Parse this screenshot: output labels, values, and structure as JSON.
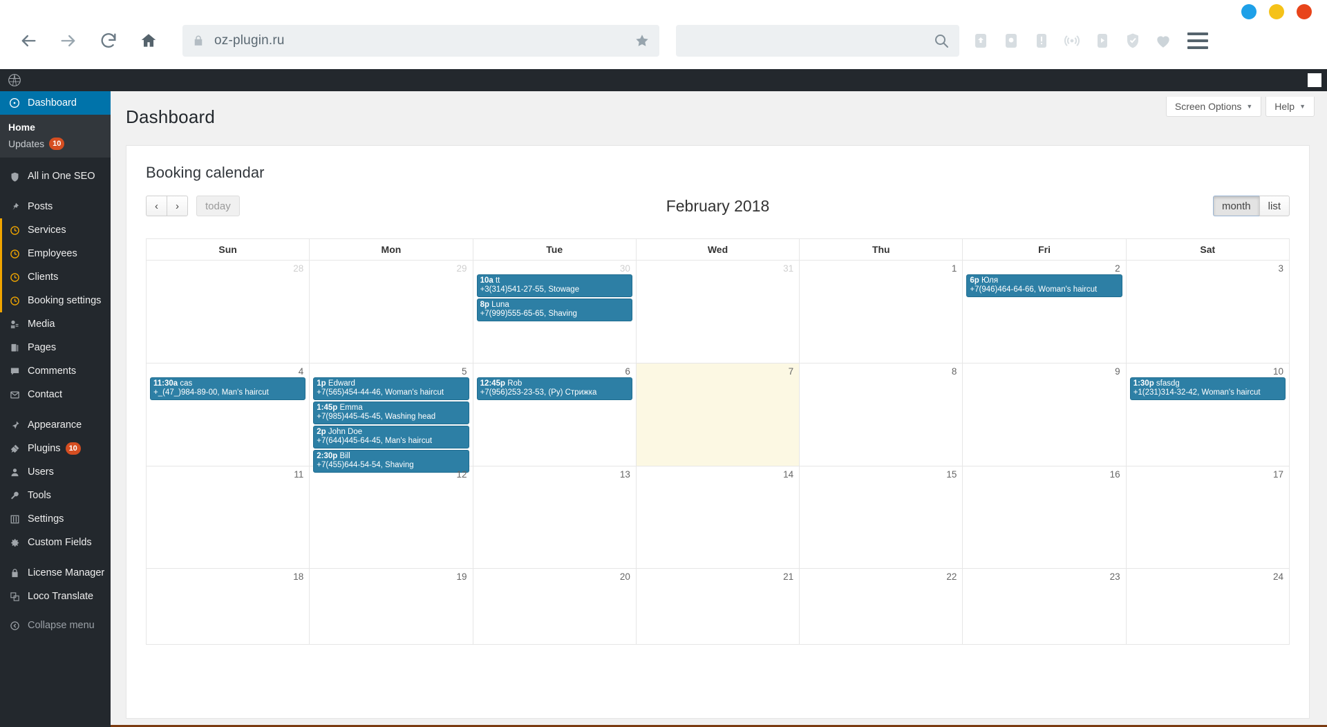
{
  "browser": {
    "url": "oz-plugin.ru",
    "url_lock_icon": "lock-icon",
    "bookmark_icon": "star-icon",
    "search_placeholder": "",
    "search_value": "",
    "nav": {
      "back": "back-arrow-icon",
      "forward": "forward-arrow-icon",
      "reload": "reload-icon",
      "home": "home-icon"
    },
    "extensions": [
      "upload-icon",
      "camera-icon",
      "alert-icon",
      "broadcast-icon",
      "save-page-icon",
      "shield-check-icon",
      "heart-icon"
    ],
    "menu_icon": "hamburger-menu-icon",
    "window_dots": [
      "#1ea0e8",
      "#f5c218",
      "#e8441a"
    ]
  },
  "adminbar": {
    "logo": "wordpress-logo-icon"
  },
  "sidebar": {
    "items": [
      {
        "label": "Dashboard",
        "icon": "dashboard-icon",
        "current": true,
        "badge": null
      },
      {
        "label": "All in One SEO",
        "icon": "shield-icon",
        "current": false,
        "badge": null
      },
      {
        "label": "Posts",
        "icon": "pin-icon",
        "current": false,
        "badge": null
      },
      {
        "label": "Services",
        "icon": "clock-icon",
        "current": false,
        "badge": null
      },
      {
        "label": "Employees",
        "icon": "clock-icon",
        "current": false,
        "badge": null
      },
      {
        "label": "Clients",
        "icon": "clock-icon",
        "current": false,
        "badge": null
      },
      {
        "label": "Booking settings",
        "icon": "clock-icon",
        "current": false,
        "badge": null
      },
      {
        "label": "Media",
        "icon": "media-icon",
        "current": false,
        "badge": null
      },
      {
        "label": "Pages",
        "icon": "pages-icon",
        "current": false,
        "badge": null
      },
      {
        "label": "Comments",
        "icon": "comments-icon",
        "current": false,
        "badge": null
      },
      {
        "label": "Contact",
        "icon": "envelope-icon",
        "current": false,
        "badge": null
      },
      {
        "label": "Appearance",
        "icon": "brush-icon",
        "current": false,
        "badge": null
      },
      {
        "label": "Plugins",
        "icon": "plug-icon",
        "current": false,
        "badge": "10"
      },
      {
        "label": "Users",
        "icon": "user-icon",
        "current": false,
        "badge": null
      },
      {
        "label": "Tools",
        "icon": "wrench-icon",
        "current": false,
        "badge": null
      },
      {
        "label": "Settings",
        "icon": "settings-sliders-icon",
        "current": false,
        "badge": null
      },
      {
        "label": "Custom Fields",
        "icon": "gear-icon",
        "current": false,
        "badge": null
      },
      {
        "label": "License Manager",
        "icon": "lock-icon",
        "current": false,
        "badge": null
      },
      {
        "label": "Loco Translate",
        "icon": "translate-icon",
        "current": false,
        "badge": null
      },
      {
        "label": "Collapse menu",
        "icon": "collapse-icon",
        "current": false,
        "badge": null
      }
    ],
    "submenu": {
      "home": "Home",
      "updates": "Updates",
      "updates_badge": "10"
    }
  },
  "screen_meta": {
    "screen_options": "Screen Options",
    "help": "Help"
  },
  "page": {
    "title": "Dashboard",
    "panel_title": "Booking calendar"
  },
  "calendar": {
    "prev_label": "‹",
    "next_label": "›",
    "today_label": "today",
    "month_title": "February 2018",
    "view_month": "month",
    "view_list": "list",
    "active_view": "month",
    "day_headers": [
      "Sun",
      "Mon",
      "Tue",
      "Wed",
      "Thu",
      "Fri",
      "Sat"
    ],
    "event_color": "#2d7fa5",
    "today_bg": "#fcf8e3",
    "weeks": [
      {
        "days": [
          {
            "num": "28",
            "other": true,
            "today": false,
            "events": []
          },
          {
            "num": "29",
            "other": true,
            "today": false,
            "events": []
          },
          {
            "num": "30",
            "other": true,
            "today": false,
            "events": [
              {
                "time": "10a",
                "title": "tt",
                "sub": "+3(314)541-27-55, Stowage"
              },
              {
                "time": "8p",
                "title": "Luna",
                "sub": "+7(999)555-65-65, Shaving"
              }
            ]
          },
          {
            "num": "31",
            "other": true,
            "today": false,
            "events": []
          },
          {
            "num": "1",
            "other": false,
            "today": false,
            "events": []
          },
          {
            "num": "2",
            "other": false,
            "today": false,
            "events": [
              {
                "time": "6p",
                "title": "Юля",
                "sub": "+7(946)464-64-66, Woman's haircut"
              }
            ]
          },
          {
            "num": "3",
            "other": false,
            "today": false,
            "events": []
          }
        ]
      },
      {
        "days": [
          {
            "num": "4",
            "other": false,
            "today": false,
            "events": [
              {
                "time": "11:30a",
                "title": "cas",
                "sub": "+_(47_)984-89-00, Man's haircut"
              }
            ]
          },
          {
            "num": "5",
            "other": false,
            "today": false,
            "events": [
              {
                "time": "1p",
                "title": "Edward",
                "sub": "+7(565)454-44-46, Woman's haircut"
              },
              {
                "time": "1:45p",
                "title": "Emma",
                "sub": "+7(985)445-45-45, Washing head"
              },
              {
                "time": "2p",
                "title": "John Doe",
                "sub": "+7(644)445-64-45, Man's haircut"
              },
              {
                "time": "2:30p",
                "title": "Bill",
                "sub": "+7(455)644-54-54, Shaving"
              }
            ]
          },
          {
            "num": "6",
            "other": false,
            "today": false,
            "events": [
              {
                "time": "12:45p",
                "title": "Rob",
                "sub": "+7(956)253-23-53, (Ру) Стрижка"
              }
            ]
          },
          {
            "num": "7",
            "other": false,
            "today": true,
            "events": []
          },
          {
            "num": "8",
            "other": false,
            "today": false,
            "events": []
          },
          {
            "num": "9",
            "other": false,
            "today": false,
            "events": []
          },
          {
            "num": "10",
            "other": false,
            "today": false,
            "events": [
              {
                "time": "1:30p",
                "title": "sfasdg",
                "sub": "+1(231)314-32-42, Woman's haircut"
              }
            ]
          }
        ]
      },
      {
        "days": [
          {
            "num": "11",
            "other": false,
            "today": false,
            "events": []
          },
          {
            "num": "12",
            "other": false,
            "today": false,
            "events": []
          },
          {
            "num": "13",
            "other": false,
            "today": false,
            "events": []
          },
          {
            "num": "14",
            "other": false,
            "today": false,
            "events": []
          },
          {
            "num": "15",
            "other": false,
            "today": false,
            "events": []
          },
          {
            "num": "16",
            "other": false,
            "today": false,
            "events": []
          },
          {
            "num": "17",
            "other": false,
            "today": false,
            "events": []
          }
        ]
      },
      {
        "days": [
          {
            "num": "18",
            "other": false,
            "today": false,
            "events": []
          },
          {
            "num": "19",
            "other": false,
            "today": false,
            "events": []
          },
          {
            "num": "20",
            "other": false,
            "today": false,
            "events": []
          },
          {
            "num": "21",
            "other": false,
            "today": false,
            "events": []
          },
          {
            "num": "22",
            "other": false,
            "today": false,
            "events": []
          },
          {
            "num": "23",
            "other": false,
            "today": false,
            "events": []
          },
          {
            "num": "24",
            "other": false,
            "today": false,
            "events": []
          }
        ]
      }
    ]
  }
}
